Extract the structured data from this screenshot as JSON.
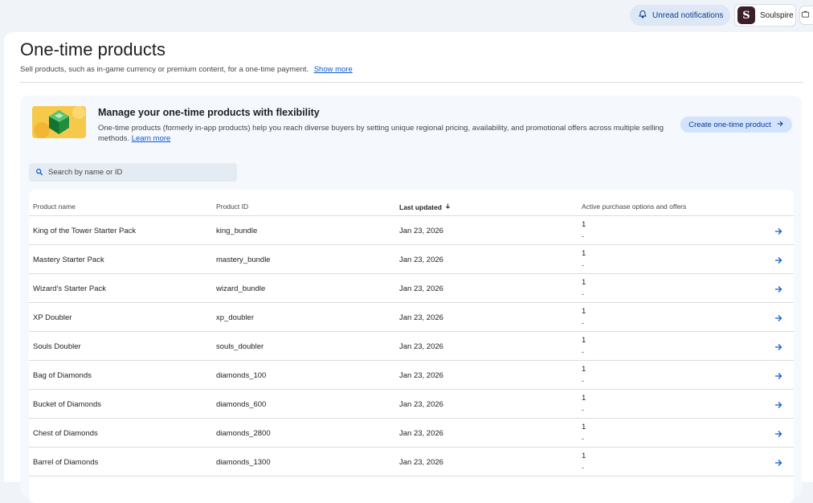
{
  "topbar": {
    "notifications_label": "Unread notifications",
    "app_name": "Soulspire",
    "app_avatar_letter": "S"
  },
  "page": {
    "title": "One-time products",
    "subtitle": "Sell products, such as in-game currency or premium content, for a one-time payment.",
    "show_more": "Show more"
  },
  "banner": {
    "heading": "Manage your one-time products with flexibility",
    "body": "One-time products (formerly in-app products) help you reach diverse buyers by setting unique regional pricing, availability, and promotional offers across multiple selling methods.",
    "learn_more": "Learn more",
    "create_button": "Create one-time product"
  },
  "search": {
    "placeholder": "Search by name or ID"
  },
  "table": {
    "headers": {
      "name": "Product name",
      "id": "Product ID",
      "updated": "Last updated",
      "active": "Active purchase options and offers"
    },
    "rows": [
      {
        "name": "King of the Tower Starter Pack",
        "id": "king_bundle",
        "updated": "Jan 23, 2026",
        "active": "1",
        "offers": "-"
      },
      {
        "name": "Mastery Starter Pack",
        "id": "mastery_bundle",
        "updated": "Jan 23, 2026",
        "active": "1",
        "offers": "-"
      },
      {
        "name": "Wizard's Starter Pack",
        "id": "wizard_bundle",
        "updated": "Jan 23, 2026",
        "active": "1",
        "offers": "-"
      },
      {
        "name": "XP Doubler",
        "id": "xp_doubler",
        "updated": "Jan 23, 2026",
        "active": "1",
        "offers": "-"
      },
      {
        "name": "Souls Doubler",
        "id": "souls_doubler",
        "updated": "Jan 23, 2026",
        "active": "1",
        "offers": "-"
      },
      {
        "name": "Bag of Diamonds",
        "id": "diamonds_100",
        "updated": "Jan 23, 2026",
        "active": "1",
        "offers": "-"
      },
      {
        "name": "Bucket of Diamonds",
        "id": "diamonds_600",
        "updated": "Jan 23, 2026",
        "active": "1",
        "offers": "-"
      },
      {
        "name": "Chest of Diamonds",
        "id": "diamonds_2800",
        "updated": "Jan 23, 2026",
        "active": "1",
        "offers": "-"
      },
      {
        "name": "Barrel of Diamonds",
        "id": "diamonds_1300",
        "updated": "Jan 23, 2026",
        "active": "1",
        "offers": "-"
      }
    ]
  },
  "icons": {
    "notifications": "bell-icon",
    "search": "search-icon",
    "row_arrow": "arrow-right-icon",
    "sort": "arrow-down-icon",
    "banner": "diamond-icon"
  },
  "colors": {
    "accent": "#0b57d0",
    "chip_bg": "#d3e3fd"
  }
}
